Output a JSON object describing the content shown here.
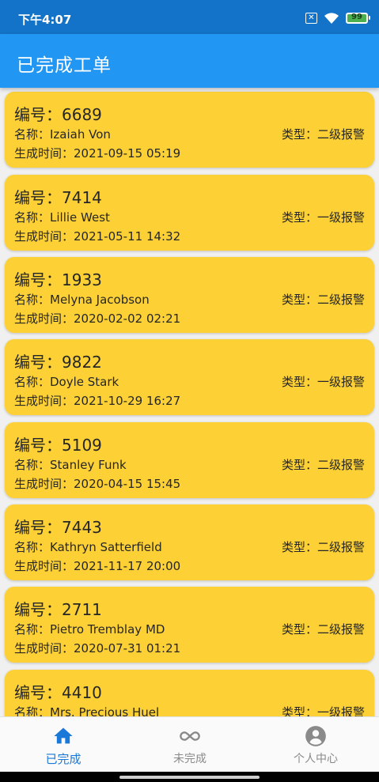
{
  "status_bar": {
    "time": "下午4:07",
    "battery_level": "99",
    "battery_color": "#4caf50",
    "icons": [
      "sim-x-icon",
      "wifi-icon",
      "battery-icon"
    ]
  },
  "app_bar": {
    "title": "已完成工单",
    "color": "#2196f3"
  },
  "work_orders": [
    {
      "id": "编号：6689",
      "name": "名称：Izaiah Von",
      "type": "类型：二级报警",
      "time": "生成时间：2021-09-15 05:19"
    },
    {
      "id": "编号：7414",
      "name": "名称：Lillie West",
      "type": "类型：一级报警",
      "time": "生成时间：2021-05-11 14:32"
    },
    {
      "id": "编号：1933",
      "name": "名称：Melyna Jacobson",
      "type": "类型：二级报警",
      "time": "生成时间：2020-02-02 02:21"
    },
    {
      "id": "编号：9822",
      "name": "名称：Doyle Stark",
      "type": "类型：一级报警",
      "time": "生成时间：2021-10-29 16:27"
    },
    {
      "id": "编号：5109",
      "name": "名称：Stanley Funk",
      "type": "类型：二级报警",
      "time": "生成时间：2020-04-15 15:45"
    },
    {
      "id": "编号：7443",
      "name": "名称：Kathryn Satterfield",
      "type": "类型：二级报警",
      "time": "生成时间：2021-11-17 20:00"
    },
    {
      "id": "编号：2711",
      "name": "名称：Pietro Tremblay MD",
      "type": "类型：二级报警",
      "time": "生成时间：2020-07-31 01:21"
    },
    {
      "id": "编号：4410",
      "name": "名称：Mrs. Precious Huel",
      "type": "类型：一级报警",
      "time": ""
    }
  ],
  "card_color": "#fdd136",
  "bottom_nav": {
    "items": [
      {
        "label": "已完成",
        "icon": "home-icon",
        "active": true
      },
      {
        "label": "未完成",
        "icon": "infinity-icon",
        "active": false
      },
      {
        "label": "个人中心",
        "icon": "account-circle-icon",
        "active": false
      }
    ],
    "active_color": "#1a78d8",
    "inactive_color": "#8a8a8a"
  }
}
